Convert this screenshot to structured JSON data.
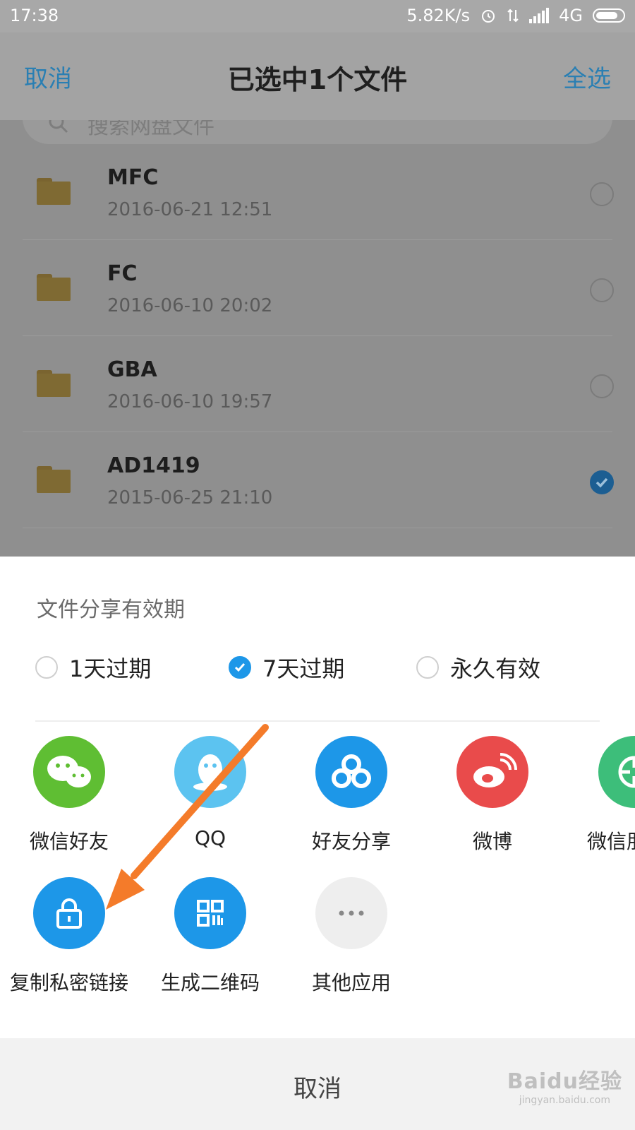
{
  "status_bar": {
    "time": "17:38",
    "speed": "5.82K/s",
    "network": "4G"
  },
  "header": {
    "cancel_label": "取消",
    "title": "已选中1个文件",
    "select_all_label": "全选"
  },
  "search": {
    "placeholder": "搜索网盘文件"
  },
  "files": [
    {
      "name": "MFC",
      "date": "2016-06-21  12:51",
      "checked": false
    },
    {
      "name": "FC",
      "date": "2016-06-10  20:02",
      "checked": false
    },
    {
      "name": "GBA",
      "date": "2016-06-10  19:57",
      "checked": false
    },
    {
      "name": "AD1419",
      "date": "2015-06-25  21:10",
      "checked": true
    }
  ],
  "share_sheet": {
    "validity_title": "文件分享有效期",
    "validity_options": [
      {
        "label": "1天过期",
        "selected": false
      },
      {
        "label": "7天过期",
        "selected": true
      },
      {
        "label": "永久有效",
        "selected": false
      }
    ],
    "apps_row1": [
      {
        "label": "微信好友",
        "icon": "wechat-icon",
        "color": "#5fbe33"
      },
      {
        "label": "QQ",
        "icon": "qq-icon",
        "color": "#5cc3f0"
      },
      {
        "label": "好友分享",
        "icon": "baidu-cloud-icon",
        "color": "#1d97e8"
      },
      {
        "label": "微博",
        "icon": "weibo-icon",
        "color": "#e94b4b"
      },
      {
        "label": "微信朋友圈",
        "icon": "moments-icon",
        "color": "#3dbe7a"
      }
    ],
    "apps_row2": [
      {
        "label": "复制私密链接",
        "icon": "lock-icon",
        "color": "#1d97e8"
      },
      {
        "label": "生成二维码",
        "icon": "qr-code-icon",
        "color": "#1d97e8"
      },
      {
        "label": "其他应用",
        "icon": "more-icon",
        "color": "#eeeeee"
      }
    ],
    "cancel_label": "取消"
  },
  "watermark": {
    "brand": "Baidu经验",
    "url": "jingyan.baidu.com"
  },
  "colors": {
    "accent": "#1d97e8",
    "annotation_arrow": "#f47b2a"
  }
}
